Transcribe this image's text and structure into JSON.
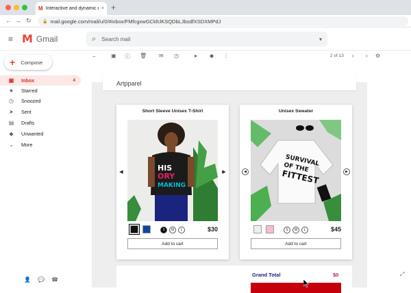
{
  "browser": {
    "tab_title": "Interactive and dynamic email",
    "tab_favicon": "M",
    "tab_close": "×",
    "new_tab": "+",
    "url": "mail.google.com/mail/u/0/#inbox/FMfcgxwGCkfclKSQDbLJbsdfXSDXMPdJ",
    "nav_back": "←",
    "nav_forward": "→",
    "nav_reload": "↻",
    "lock": "🔒"
  },
  "gmail": {
    "logo_letter": "M",
    "logo_text": "Gmail",
    "menu_glyph": "≡",
    "search_placeholder": "Search mail",
    "search_glyph": "⌕",
    "search_options_glyph": "▾"
  },
  "sidebar": {
    "compose_label": "Compose",
    "compose_glyph": "+",
    "items": [
      {
        "label": "Inbox",
        "icon": "inbox-icon",
        "glyph": "▣",
        "count": "4",
        "active": true
      },
      {
        "label": "Starred",
        "icon": "star-icon",
        "glyph": "★",
        "count": ""
      },
      {
        "label": "Snoozed",
        "icon": "clock-icon",
        "glyph": "◷",
        "count": ""
      },
      {
        "label": "Sent",
        "icon": "send-icon",
        "glyph": "➤",
        "count": ""
      },
      {
        "label": "Drafts",
        "icon": "draft-icon",
        "glyph": "▤",
        "count": ""
      },
      {
        "label": "Unwanted",
        "icon": "label-icon",
        "glyph": "◆",
        "count": ""
      },
      {
        "label": "More",
        "icon": "chevron-down-icon",
        "glyph": "⌄",
        "count": ""
      }
    ],
    "footer": {
      "contacts": "👤",
      "hangouts": "💬",
      "phone": "☎"
    }
  },
  "actions": {
    "back": "←",
    "archive": "▣",
    "spam": "ⓘ",
    "delete": "🗑",
    "unread": "✉",
    "snooze": "◷",
    "move": "▸",
    "label": "◆",
    "more": "⋮",
    "page_count": "2 of 13",
    "prev": "‹",
    "next": "›",
    "settings": "⚙"
  },
  "email": {
    "sender": "Artpparel",
    "products": [
      {
        "name": "Short Sleeve Unisex T-Shirt",
        "price": "$30",
        "cart_label": "Add to cart",
        "swatches": [
          "#111111",
          "#0d47a1"
        ],
        "selected_swatch": 0,
        "sizes": [
          "S",
          "M",
          "L"
        ],
        "selected_size": "S",
        "arrow_left": "◀",
        "arrow_right": "▶"
      },
      {
        "name": "Unisex Sweater",
        "price": "$45",
        "cart_label": "Add to cart",
        "swatches": [
          "#eeeeee",
          "#f8bbd0"
        ],
        "selected_swatch": 0,
        "sizes": [
          "S",
          "M",
          "L"
        ],
        "selected_size": "",
        "arrow_left": "◀",
        "arrow_right": "▶"
      }
    ],
    "grand_total_label": "Grand Total",
    "grand_total_value": "$0"
  },
  "colors": {
    "accent_red": "#d93025",
    "grand_total_label": "#1a237e",
    "grand_total_value": "#c2185b",
    "checkout_bar": "#c5000b"
  }
}
